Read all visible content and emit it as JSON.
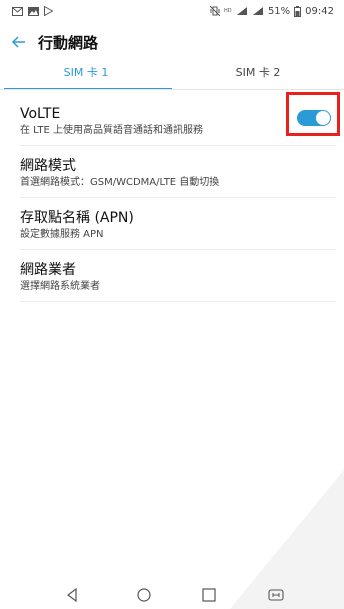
{
  "status_bar": {
    "left_icons": [
      "mail-icon",
      "image-icon",
      "play-store-icon"
    ],
    "battery_percent": "51%",
    "time": "09:42",
    "right_icons": [
      "vibrate-icon",
      "hd-icon",
      "signal-icon",
      "signal-icon",
      "battery-icon"
    ]
  },
  "header": {
    "title": "行動網路",
    "back_icon": "arrow-left-icon"
  },
  "tabs": [
    {
      "label": "SIM 卡 1",
      "active": true
    },
    {
      "label": "SIM 卡 2",
      "active": false
    }
  ],
  "settings": {
    "volte": {
      "title": "VoLTE",
      "subtitle": "在 LTE 上使用高品質語音通話和通訊服務",
      "enabled": true
    },
    "network_mode": {
      "title": "網路模式",
      "subtitle": "首選網路模式：GSM/WCDMA/LTE 自動切換"
    },
    "apn": {
      "title": "存取點名稱 (APN)",
      "subtitle": "設定數據服務 APN"
    },
    "carrier": {
      "title": "網路業者",
      "subtitle": "選擇網路系統業者"
    }
  },
  "colors": {
    "accent": "#2a9bd7",
    "highlight": "#e8201e"
  },
  "nav_bar": [
    "back-triangle-icon",
    "home-circle-icon",
    "recents-square-icon",
    "screen-mirror-icon"
  ]
}
